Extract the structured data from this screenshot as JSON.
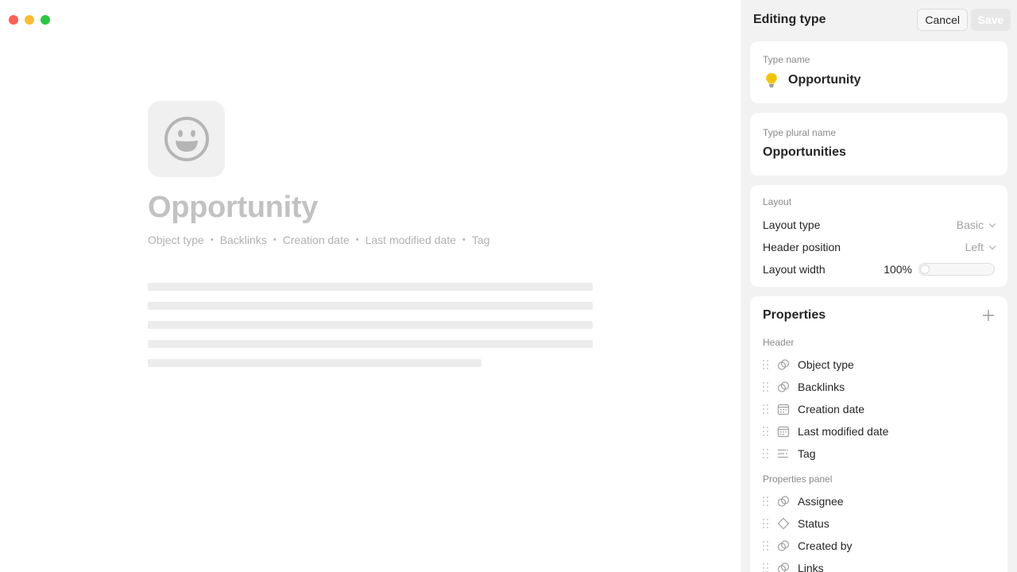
{
  "preview": {
    "icon": "grinning-face-icon",
    "title": "Opportunity",
    "meta": [
      "Object type",
      "Backlinks",
      "Creation date",
      "Last modified date",
      "Tag"
    ],
    "separator": "•"
  },
  "panel": {
    "title": "Editing type",
    "cancel_label": "Cancel",
    "save_label": "Save",
    "type_name": {
      "label": "Type name",
      "value": "Opportunity",
      "icon": "lightbulb-icon"
    },
    "plural_name": {
      "label": "Type plural name",
      "value": "Opportunities"
    },
    "layout": {
      "label": "Layout",
      "layout_type": {
        "label": "Layout type",
        "value": "Basic"
      },
      "header_position": {
        "label": "Header position",
        "value": "Left"
      },
      "layout_width": {
        "label": "Layout width",
        "value": "100%"
      }
    },
    "properties": {
      "title": "Properties",
      "header_label": "Header",
      "header_items": [
        {
          "label": "Object type",
          "icon": "relation-icon"
        },
        {
          "label": "Backlinks",
          "icon": "relation-icon"
        },
        {
          "label": "Creation date",
          "icon": "calendar-icon"
        },
        {
          "label": "Last modified date",
          "icon": "calendar-icon"
        },
        {
          "label": "Tag",
          "icon": "tag-list-icon"
        }
      ],
      "panel_label": "Properties panel",
      "panel_items": [
        {
          "label": "Assignee",
          "icon": "relation-icon"
        },
        {
          "label": "Status",
          "icon": "status-icon"
        },
        {
          "label": "Created by",
          "icon": "relation-icon"
        },
        {
          "label": "Links",
          "icon": "relation-icon"
        }
      ]
    }
  },
  "colors": {
    "accent_icon": "#f2c400",
    "panel_bg": "#f2f2f2"
  }
}
